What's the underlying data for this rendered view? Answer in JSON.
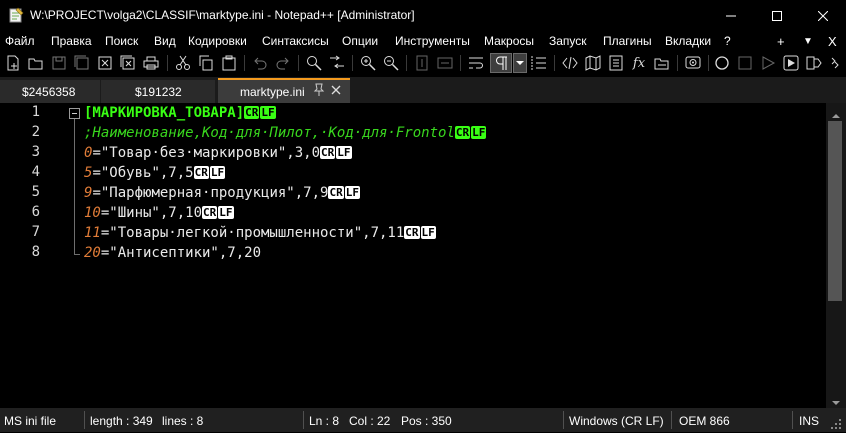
{
  "window": {
    "title": "W:\\PROJECT\\volga2\\CLASSIF\\marktype.ini - Notepad++ [Administrator]",
    "controls": [
      "minimize-icon",
      "maximize-icon",
      "close-icon"
    ]
  },
  "menu": {
    "items": [
      "Файл",
      "Правка",
      "Поиск",
      "Вид",
      "Кодировки",
      "Синтаксисы",
      "Опции",
      "Инструменты",
      "Макросы",
      "Запуск",
      "Плагины",
      "Вкладки",
      "?"
    ],
    "right": [
      "+",
      "▼",
      "X"
    ]
  },
  "toolbar": {
    "icons": [
      "new-file-icon",
      "open-file-icon",
      "save-icon",
      "save-all-icon",
      "close-file-icon",
      "close-all-icon",
      "print-icon",
      "cut-icon",
      "copy-icon",
      "paste-icon",
      "undo-icon",
      "redo-icon",
      "find-icon",
      "replace-icon",
      "zoom-in-icon",
      "zoom-out-icon",
      "sync-vertical-icon",
      "sync-horizontal-icon",
      "word-wrap-icon",
      "show-all-chars-icon",
      "show-all-dropdown-icon",
      "indent-guide-icon",
      "xml-tag-icon",
      "document-map-icon",
      "function-list-icon",
      "fx-icon",
      "folder-workspace-icon",
      "monitoring-icon",
      "record-macro-icon",
      "stop-record-icon",
      "play-macro-icon",
      "run-macro-multiple-icon",
      "save-macro-icon"
    ]
  },
  "tabs": [
    {
      "label": "$2456358",
      "active": false
    },
    {
      "label": "$191232",
      "active": false
    },
    {
      "label": "marktype.ini",
      "active": true
    }
  ],
  "editor": {
    "lines": [
      {
        "number": "1",
        "parts": [
          {
            "type": "sec",
            "text": "[МАРКИРОВКА_ТОВАРА]"
          },
          {
            "type": "eol",
            "text": "CR",
            "green": true
          },
          {
            "type": "eol",
            "text": "LF",
            "green": true
          }
        ]
      },
      {
        "number": "2",
        "parts": [
          {
            "type": "cmt",
            "text": ";Наименование,Код·для·Пилот,·Код·для·Frontol"
          },
          {
            "type": "eol",
            "text": "CR",
            "green": true
          },
          {
            "type": "eol",
            "text": "LF",
            "green": true
          }
        ]
      },
      {
        "number": "3",
        "parts": [
          {
            "type": "key",
            "text": "0"
          },
          {
            "type": "val",
            "text": "=\"Товар·без·маркировки\",3,0"
          },
          {
            "type": "eol",
            "text": "CR"
          },
          {
            "type": "eol",
            "text": "LF"
          }
        ]
      },
      {
        "number": "4",
        "parts": [
          {
            "type": "key",
            "text": "5"
          },
          {
            "type": "val",
            "text": "=\"Обувь\",7,5"
          },
          {
            "type": "eol",
            "text": "CR"
          },
          {
            "type": "eol",
            "text": "LF"
          }
        ]
      },
      {
        "number": "5",
        "parts": [
          {
            "type": "key",
            "text": "9"
          },
          {
            "type": "val",
            "text": "=\"Парфюмерная·продукция\",7,9"
          },
          {
            "type": "eol",
            "text": "CR"
          },
          {
            "type": "eol",
            "text": "LF"
          }
        ]
      },
      {
        "number": "6",
        "parts": [
          {
            "type": "key",
            "text": "10"
          },
          {
            "type": "val",
            "text": "=\"Шины\",7,10"
          },
          {
            "type": "eol",
            "text": "CR"
          },
          {
            "type": "eol",
            "text": "LF"
          }
        ]
      },
      {
        "number": "7",
        "parts": [
          {
            "type": "key",
            "text": "11"
          },
          {
            "type": "val",
            "text": "=\"Товары·легкой·промышленности\",7,11"
          },
          {
            "type": "eol",
            "text": "CR"
          },
          {
            "type": "eol",
            "text": "LF"
          }
        ]
      },
      {
        "number": "8",
        "parts": [
          {
            "type": "key",
            "text": "20"
          },
          {
            "type": "val",
            "text": "=\"Антисептики\",7,20"
          }
        ]
      }
    ]
  },
  "status": {
    "language": "MS ini file",
    "length": "length : 349",
    "lines": "lines : 8",
    "ln": "Ln : 8",
    "col": "Col : 22",
    "pos": "Pos : 350",
    "eol_format": "Windows (CR LF)",
    "encoding": "OEM 866",
    "mode": "INS"
  },
  "colors": {
    "section": "#39ff14",
    "comment": "#39d71e",
    "key": "#e07c38",
    "value": "#eaeaea",
    "tab_accent": "#f49b1f"
  }
}
